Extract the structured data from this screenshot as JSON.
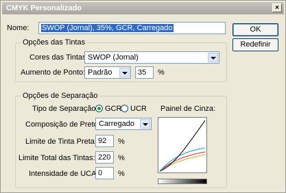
{
  "window": {
    "title": "CMYK Personalizado",
    "close_glyph": "×"
  },
  "name": {
    "label": "Nome:",
    "value": "SWOP (Jornal), 35%, GCR, Carregado"
  },
  "buttons": {
    "ok": "OK",
    "reset": "Redefinir"
  },
  "ink_options": {
    "title": "Opções das Tintas",
    "ink_colors": {
      "label": "Cores das Tintas:",
      "value": "SWOP (Jornal)"
    },
    "dot_gain": {
      "label": "Aumento de Ponto:",
      "mode": "Padrão",
      "value": "35",
      "unit": "%"
    }
  },
  "separation_options": {
    "title": "Opções de Separação",
    "separation_type": {
      "label": "Tipo de Separação:",
      "options": [
        "GCR",
        "UCR"
      ],
      "selected": "GCR"
    },
    "gray_panel_label": "Painel de Cinza:",
    "black_generation": {
      "label": "Composição de Preto:",
      "value": "Carregado"
    },
    "black_ink_limit": {
      "label": "Limite de Tinta Preta:",
      "value": "92",
      "unit": "%"
    },
    "total_ink_limit": {
      "label": "Limite Total das Tintas:",
      "value": "220",
      "unit": "%"
    },
    "uca_amount": {
      "label": "Intensidade de UCA:",
      "value": "0",
      "unit": "%"
    }
  },
  "curve_colors": {
    "cyan": "#3aa6c9",
    "magenta": "#d9456a",
    "yellow": "#c9c040",
    "black": "#222222"
  }
}
